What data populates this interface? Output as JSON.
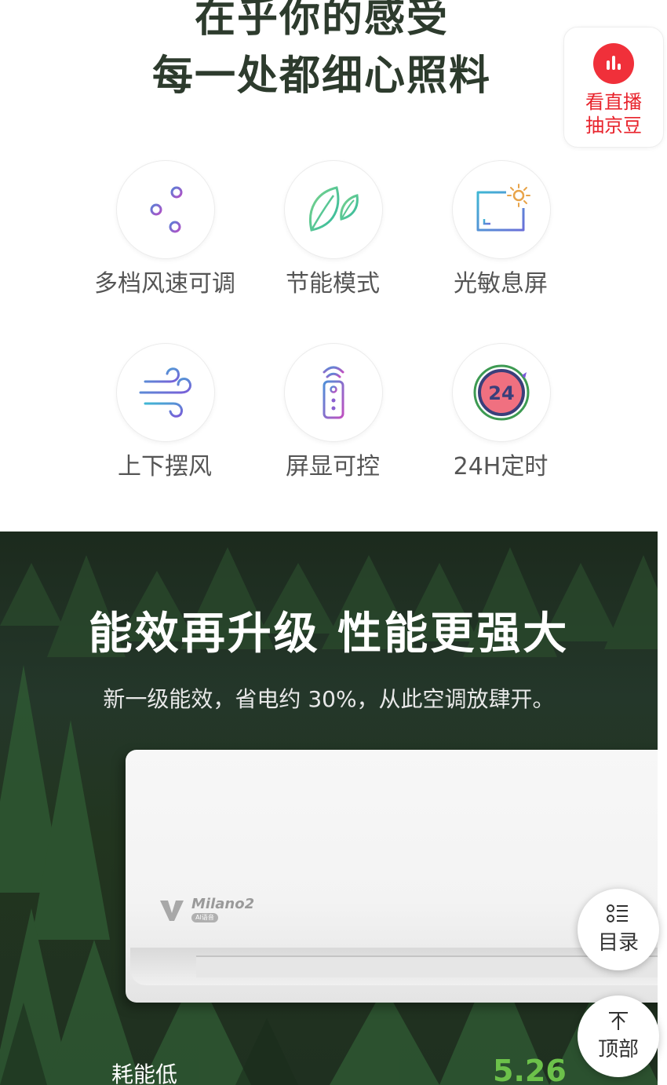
{
  "headline": {
    "line1": "在乎你的感受",
    "line2": "每一处都细心照料"
  },
  "live_widget": {
    "line1": "看直播",
    "line2": "抽京豆",
    "icon": "live-bars-icon",
    "color": "#f0303a"
  },
  "features": [
    {
      "label": "多档风速可调",
      "icon": "sliders-icon"
    },
    {
      "label": "节能模式",
      "icon": "leaf-icon"
    },
    {
      "label": "光敏息屏",
      "icon": "screen-sun-icon"
    },
    {
      "label": "上下摆风",
      "icon": "wind-icon"
    },
    {
      "label": "屏显可控",
      "icon": "remote-control-icon"
    },
    {
      "label": "24H定时",
      "icon": "timer-24-icon",
      "timer_text": "24"
    }
  ],
  "banner": {
    "title": "能效再升级 性能更强大",
    "subtitle": "新一级能效，省电约 30%，从此空调放肆开。",
    "product_model": "Milano2",
    "product_badge": "AI语音",
    "energy_label": "耗能低",
    "energy_value": "5.26",
    "accent_color": "#6cc14a"
  },
  "floating_buttons": {
    "catalog": {
      "label": "目录",
      "icon": "list-icon"
    },
    "top": {
      "label": "顶部",
      "icon": "arrow-up-icon"
    }
  }
}
